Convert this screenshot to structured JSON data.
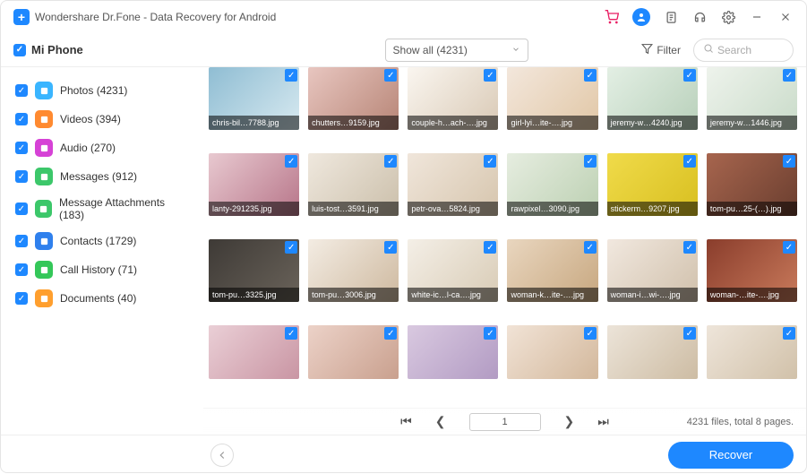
{
  "titlebar": {
    "app_name": "Wondershare Dr.Fone - Data Recovery for Android"
  },
  "toolbar": {
    "device_label": "Mi Phone",
    "dropdown_label": "Show all (4231)",
    "filter_label": "Filter",
    "search_placeholder": "Search"
  },
  "sidebar": {
    "items": [
      {
        "label": "Photos (4231)",
        "icon_color": "#3ab5ff"
      },
      {
        "label": "Videos (394)",
        "icon_color": "#ff8a30"
      },
      {
        "label": "Audio (270)",
        "icon_color": "#d642d6"
      },
      {
        "label": "Messages (912)",
        "icon_color": "#3cc76a"
      },
      {
        "label": "Message Attachments (183)",
        "icon_color": "#3cc76a"
      },
      {
        "label": "Contacts (1729)",
        "icon_color": "#2f80ed"
      },
      {
        "label": "Call History (71)",
        "icon_color": "#34c759"
      },
      {
        "label": "Documents (40)",
        "icon_color": "#ff9f2e"
      }
    ]
  },
  "grid": {
    "rows": [
      [
        {
          "caption": "chris-bil…7788.jpg",
          "cls": "fi1"
        },
        {
          "caption": "chutters…9159.jpg",
          "cls": "fi2"
        },
        {
          "caption": "couple-h…ach-….jpg",
          "cls": "fi3"
        },
        {
          "caption": "girl-lyi…ite-….jpg",
          "cls": "fi4"
        },
        {
          "caption": "jeremy-w…4240.jpg",
          "cls": "fi5"
        },
        {
          "caption": "jeremy-w…1446.jpg",
          "cls": "fi6"
        }
      ],
      [
        {
          "caption": "lanty-291235.jpg",
          "cls": "fi7"
        },
        {
          "caption": "luis-tost…3591.jpg",
          "cls": "fi8"
        },
        {
          "caption": "petr-ova…5824.jpg",
          "cls": "fi9"
        },
        {
          "caption": "rawpixel…3090.jpg",
          "cls": "fi10"
        },
        {
          "caption": "stickerm…9207.jpg",
          "cls": "fi11"
        },
        {
          "caption": "tom-pu…25-(…).jpg",
          "cls": "fi12"
        }
      ],
      [
        {
          "caption": "tom-pu…3325.jpg",
          "cls": "fi13"
        },
        {
          "caption": "tom-pu…3006.jpg",
          "cls": "fi14"
        },
        {
          "caption": "white-ic…l-ca….jpg",
          "cls": "fi15"
        },
        {
          "caption": "woman-k…ite-….jpg",
          "cls": "fi16"
        },
        {
          "caption": "woman-i…wi-….jpg",
          "cls": "fi17"
        },
        {
          "caption": "woman-…ite-….jpg",
          "cls": "fi18"
        }
      ],
      [
        {
          "caption": "",
          "cls": "fi19"
        },
        {
          "caption": "",
          "cls": "fi20"
        },
        {
          "caption": "",
          "cls": "fi21"
        },
        {
          "caption": "",
          "cls": "fi22"
        },
        {
          "caption": "",
          "cls": "fi23"
        },
        {
          "caption": "",
          "cls": "fi24"
        }
      ]
    ]
  },
  "pager": {
    "page": "1",
    "status": "4231 files, total 8 pages."
  },
  "footer": {
    "recover_label": "Recover"
  }
}
